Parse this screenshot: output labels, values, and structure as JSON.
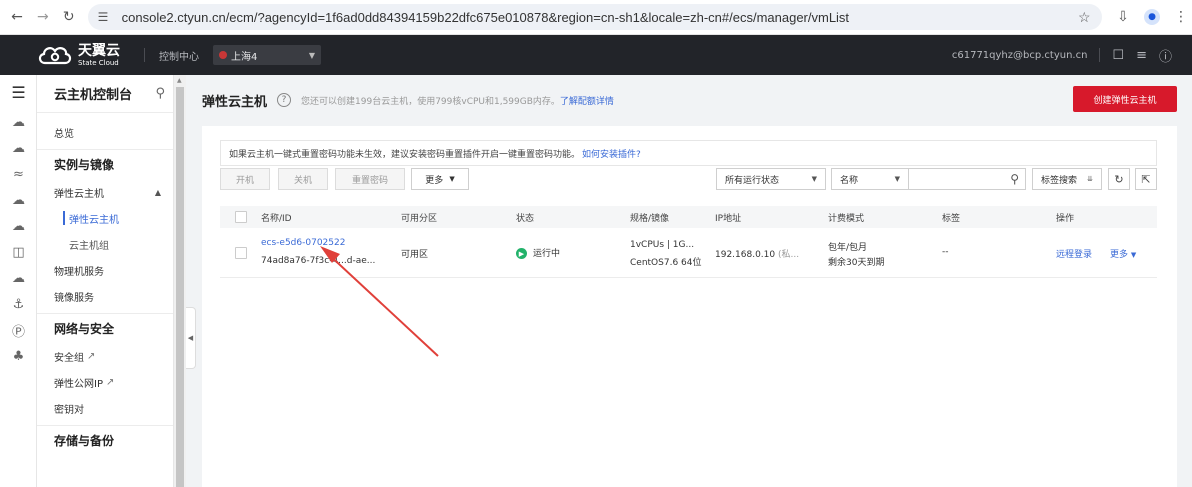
{
  "browser": {
    "url": "console2.ctyun.cn/ecm/?agencyId=1f6ad0dd84394159b22dfc675e010878&region=cn-sh1&locale=zh-cn#/ecs/manager/vmList"
  },
  "topbar": {
    "logo_cn": "天翼云",
    "logo_en": "State Cloud",
    "console_label": "控制中心",
    "region": "上海4",
    "account": "c61771qyhz@bcp.ctyun.cn"
  },
  "sidebar": {
    "title": "云主机控制台",
    "overview": "总览",
    "group1": "实例与镜像",
    "ecs": "弹性云主机",
    "ecs_sub1": "弹性云主机",
    "ecs_sub2": "云主机组",
    "bms": "物理机服务",
    "image": "镜像服务",
    "group2": "网络与安全",
    "secgroup": "安全组",
    "eip": "弹性公网IP",
    "keypair": "密钥对",
    "group3": "存储与备份"
  },
  "page": {
    "title": "弹性云主机",
    "quota_note": "您还可以创建199台云主机，使用799核vCPU和1,599GB内存。",
    "quota_link": "了解配额详情",
    "create_button": "创建弹性云主机"
  },
  "tip": {
    "text": "如果云主机一键式重置密码功能未生效，建议安装密码重置插件开启一键重置密码功能。",
    "link": "如何安装插件?"
  },
  "toolbar": {
    "start": "开机",
    "stop": "关机",
    "reset_pwd": "重置密码",
    "more": "更多",
    "status_filter": "所有运行状态",
    "search_field": "名称",
    "tag_search": "标签搜索"
  },
  "table": {
    "headers": [
      "名称/ID",
      "可用分区",
      "状态",
      "规格/镜像",
      "IP地址",
      "计费模式",
      "标签",
      "操作"
    ],
    "rows": [
      {
        "name": "ecs-e5d6-0702522",
        "id": "74ad8a76-7f3c-4...d-ae...",
        "zone": "可用区",
        "status": "运行中",
        "spec": "1vCPUs | 1G...",
        "image": "CentOS7.6 64位",
        "ip": "192.168.0.10",
        "ip_type": "(私...",
        "billing": "包年/包月",
        "expiry": "剩余30天到期",
        "tags": "--",
        "op_remote": "远程登录",
        "op_more": "更多"
      }
    ]
  }
}
